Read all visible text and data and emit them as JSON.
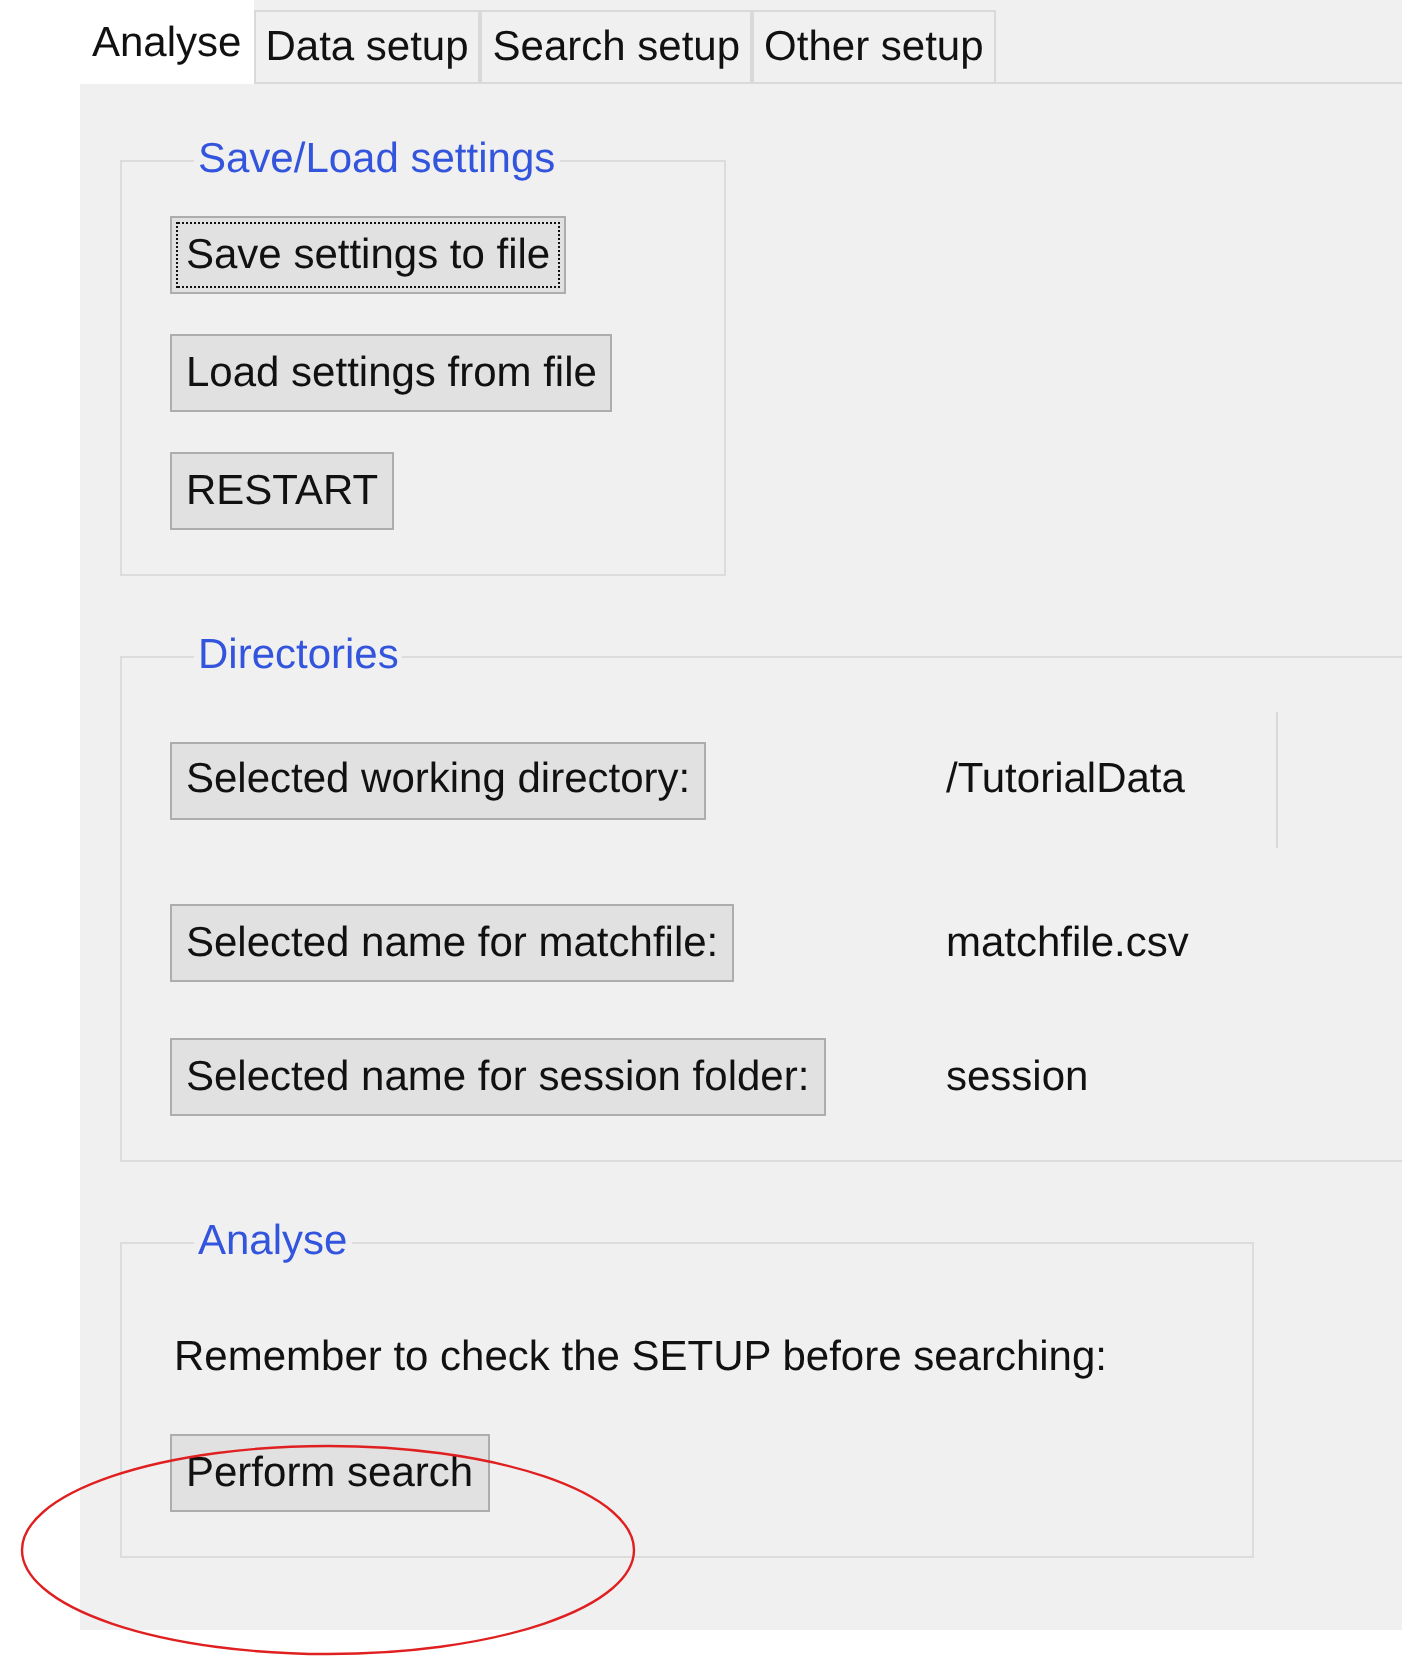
{
  "tabs": [
    {
      "label": "Analyse",
      "selected": true
    },
    {
      "label": "Data setup",
      "selected": false
    },
    {
      "label": "Search setup",
      "selected": false
    },
    {
      "label": "Other setup",
      "selected": false
    }
  ],
  "save_load_settings": {
    "title": "Save/Load settings",
    "buttons": [
      {
        "label": "Save settings to file",
        "focused": true
      },
      {
        "label": "Load settings from file",
        "focused": false
      },
      {
        "label": "RESTART",
        "focused": false
      }
    ]
  },
  "directories": {
    "title": "Directories",
    "rows": [
      {
        "button": "Selected working directory:",
        "value": "/TutorialData"
      },
      {
        "button": "Selected name for matchfile:",
        "value": "matchfile.csv"
      },
      {
        "button": "Selected name for session folder:",
        "value": "session"
      }
    ]
  },
  "analyse": {
    "title": "Analyse",
    "note": "Remember to check the SETUP before searching:",
    "button": "Perform search"
  }
}
